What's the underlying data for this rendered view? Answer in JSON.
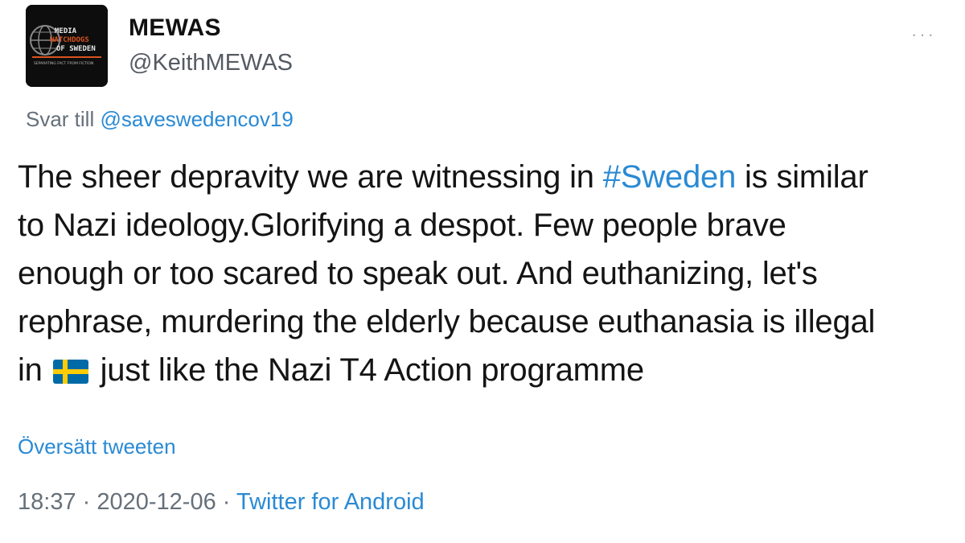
{
  "author": {
    "display_name": "MEWAS",
    "handle": "@KeithMEWAS",
    "avatar_logo": {
      "line1": "MEDIA",
      "line2": "WATCHDOGS",
      "line3": "OF SWEDEN",
      "tagline": "SEPARATING FACT FROM FICTION"
    }
  },
  "more_menu": {
    "icon": "more-dots-icon",
    "label": "···"
  },
  "reply": {
    "prefix": "Svar till",
    "mention": "@saveswedencov19"
  },
  "tweet": {
    "line1_a": "The sheer depravity we are witnessing in ",
    "line1_hashtag": "#Sweden",
    "line1_b": " is similar",
    "line2": "to Nazi ideology.Glorifying a despot. Few people brave",
    "line3": "enough or too scared to speak out. And euthanizing, let's",
    "line4": "rephrase, murdering the elderly because euthanasia is illegal",
    "line5_a": "in",
    "line5_emoji": "flag-sweden-icon",
    "line5_b": " just like the Nazi T4 Action programme"
  },
  "translate_label": "Översätt tweeten",
  "meta": {
    "time": "18:37",
    "separator": " · ",
    "date": "2020-12-06",
    "source": "Twitter for Android"
  },
  "colors": {
    "link": "#2a8ad4",
    "muted": "#66707a",
    "flag_blue": "#006aa7",
    "flag_yellow": "#fecc00"
  }
}
